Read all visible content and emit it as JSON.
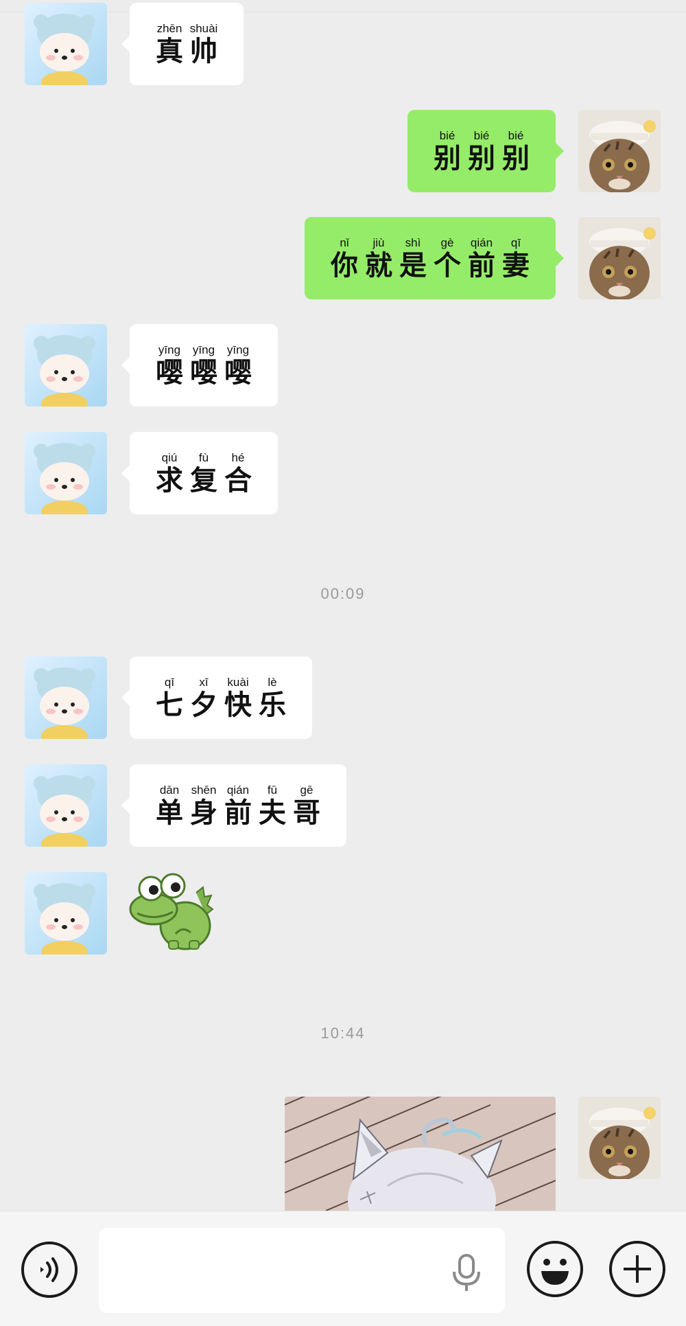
{
  "chat": {
    "messages": [
      {
        "side": "left",
        "sender": "bear",
        "chars": [
          {
            "py": "zhēn",
            "hz": "真"
          },
          {
            "py": "shuài",
            "hz": "帅"
          }
        ]
      },
      {
        "side": "right",
        "sender": "cat",
        "chars": [
          {
            "py": "bié",
            "hz": "别"
          },
          {
            "py": "bié",
            "hz": "别"
          },
          {
            "py": "bié",
            "hz": "别"
          }
        ]
      },
      {
        "side": "right",
        "sender": "cat",
        "chars": [
          {
            "py": "nǐ",
            "hz": "你"
          },
          {
            "py": "jiù",
            "hz": "就"
          },
          {
            "py": "shì",
            "hz": "是"
          },
          {
            "py": "gè",
            "hz": "个"
          },
          {
            "py": "qián",
            "hz": "前"
          },
          {
            "py": "qī",
            "hz": "妻"
          }
        ]
      },
      {
        "side": "left",
        "sender": "bear",
        "chars": [
          {
            "py": "yīng",
            "hz": "嘤"
          },
          {
            "py": "yīng",
            "hz": "嘤"
          },
          {
            "py": "yīng",
            "hz": "嘤"
          }
        ]
      },
      {
        "side": "left",
        "sender": "bear",
        "chars": [
          {
            "py": "qiú",
            "hz": "求"
          },
          {
            "py": "fù",
            "hz": "复"
          },
          {
            "py": "hé",
            "hz": "合"
          }
        ]
      },
      {
        "timestamp": "00:09"
      },
      {
        "side": "left",
        "sender": "bear",
        "chars": [
          {
            "py": "qī",
            "hz": "七"
          },
          {
            "py": "xī",
            "hz": "夕"
          },
          {
            "py": "kuài",
            "hz": "快"
          },
          {
            "py": "lè",
            "hz": "乐"
          }
        ]
      },
      {
        "side": "left",
        "sender": "bear",
        "chars": [
          {
            "py": "dān",
            "hz": "单"
          },
          {
            "py": "shēn",
            "hz": "身"
          },
          {
            "py": "qián",
            "hz": "前"
          },
          {
            "py": "fū",
            "hz": "夫"
          },
          {
            "py": "gē",
            "hz": "哥"
          }
        ]
      },
      {
        "side": "left",
        "sender": "bear",
        "sticker": "green-dinosaur-sticker"
      },
      {
        "timestamp": "10:44"
      },
      {
        "side": "right",
        "sender": "cat",
        "image": "anime-cat-girl-image"
      }
    ]
  },
  "input_bar": {
    "voice_icon": "voice-icon",
    "mic_icon": "microphone-icon",
    "emoji_icon": "emoji-icon",
    "plus_icon": "plus-icon",
    "text_value": ""
  },
  "colors": {
    "background": "#ededed",
    "self_bubble": "#95ec69",
    "other_bubble": "#ffffff",
    "timestamp": "#9a9a9a"
  }
}
